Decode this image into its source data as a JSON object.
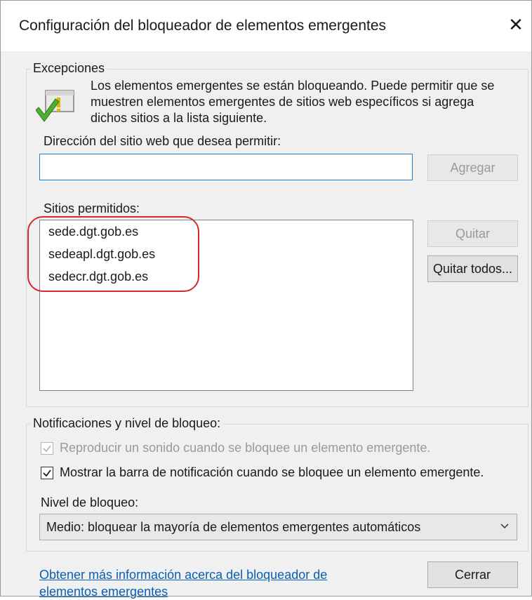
{
  "window": {
    "title": "Configuración del bloqueador de elementos emergentes",
    "close_glyph": "✕"
  },
  "exceptions": {
    "group_label": "Excepciones",
    "icon": "shield-check-icon",
    "description_lines": [
      "Los elementos emergentes se están bloqueando. Puede permitir que se",
      "muestren elementos emergentes de sitios web específicos si agrega",
      "dichos sitios a la lista siguiente."
    ],
    "address_label": "Dirección del sitio web que desea permitir:",
    "address_value": "",
    "add_button": "Agregar",
    "allowed_label": "Sitios permitidos:",
    "allowed_sites": [
      "sede.dgt.gob.es",
      "sedeapl.dgt.gob.es",
      "sedecr.dgt.gob.es"
    ],
    "remove_button": "Quitar",
    "remove_all_button": "Quitar todos..."
  },
  "notifications": {
    "group_label": "Notificaciones y nivel de bloqueo:",
    "play_sound": {
      "label": "Reproducir un sonido cuando se bloquee un elemento emergente.",
      "checked": true,
      "enabled": false
    },
    "show_bar": {
      "label": "Mostrar la barra de notificación cuando se bloquee un elemento emergente.",
      "checked": true,
      "enabled": true
    },
    "level_label": "Nivel de bloqueo:",
    "level_value": "Medio: bloquear la mayoría de elementos emergentes automáticos"
  },
  "footer": {
    "learn_more_link": "Obtener más información acerca del bloqueador de elementos emergentes",
    "close_button": "Cerrar"
  },
  "colors": {
    "accent": "#1e7fd6",
    "highlight": "#d9262e",
    "link": "#0a5fb3"
  }
}
